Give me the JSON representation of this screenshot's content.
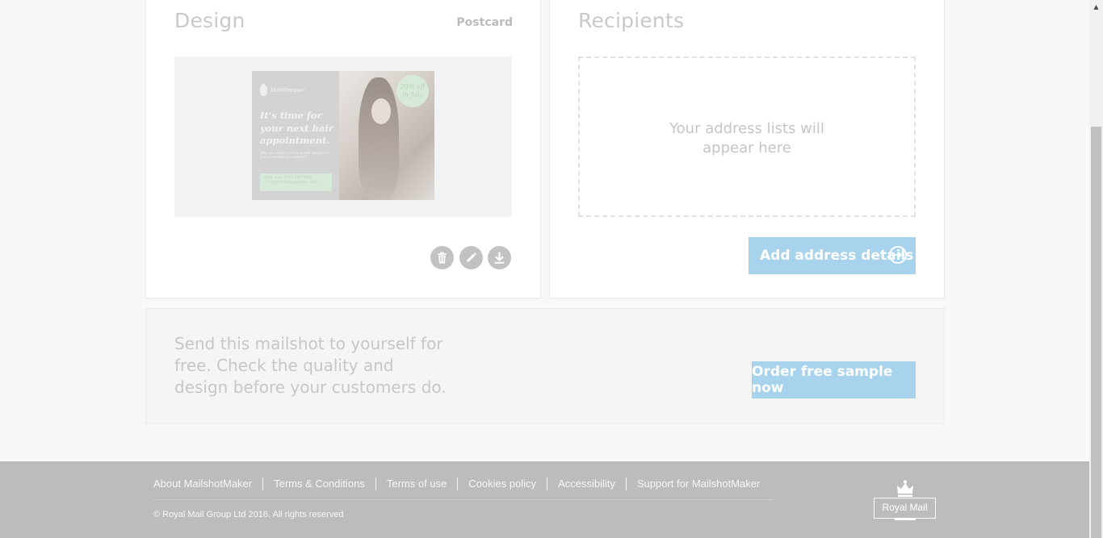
{
  "design": {
    "title": "Design",
    "format": "Postcard",
    "postcard": {
      "brand": "Hairdresser",
      "headline": "It's time for your next hair appointment.",
      "body": "Why not contact us now to talk about your brand new look for summer?",
      "cta_line1": "Book now: 0123 456 7890",
      "cta_line2": "or hairdresser@example.com",
      "badge": "20% off in July"
    },
    "actions": {
      "delete_icon": "trash-icon",
      "edit_icon": "pencil-icon",
      "download_icon": "download-icon"
    }
  },
  "recipients": {
    "title": "Recipients",
    "empty_state": "Your address lists will appear here",
    "add_button": "Add address details"
  },
  "promo": {
    "text": "Send this mailshot to yourself for free. Check the quality and design before your customers do.",
    "button": "Order free sample now"
  },
  "footer": {
    "links": [
      "About MailshotMaker",
      "Terms & Conditions",
      "Terms of use",
      "Cookies policy",
      "Accessibility",
      "Support for MailshotMaker"
    ],
    "copyright": "© Royal Mail Group Ltd 2016. All rights reserved",
    "logo_text": "Royal Mail"
  },
  "colors": {
    "accent_button": "#a7d3ec",
    "footer_bg": "#bcbcbc",
    "page_bg": "#f8f8f7"
  }
}
